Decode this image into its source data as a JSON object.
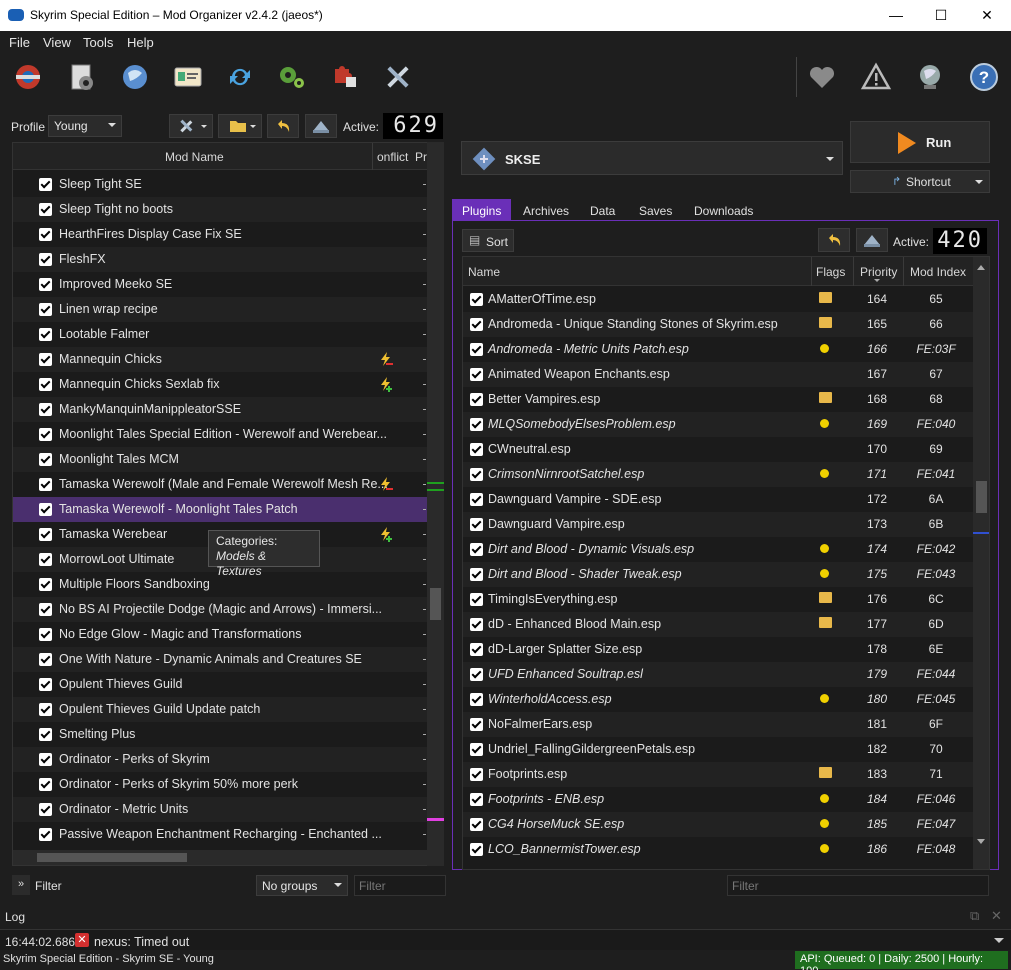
{
  "window": {
    "title": "Skyrim Special Edition – Mod Organizer v2.4.2 (jaeos*)",
    "minimize": "—",
    "maximize": "☐",
    "close": "✕"
  },
  "menu": [
    "File",
    "View",
    "Tools",
    "Help"
  ],
  "toolbar_icons": [
    "profiles-icon",
    "instance-icon",
    "browser-icon",
    "nexus-id-icon",
    "refresh-icon",
    "settings-gears-icon",
    "puzzle-icon",
    "tools-icon",
    "endorse-heart-icon",
    "warning-icon",
    "update-globe-icon",
    "help-icon"
  ],
  "left": {
    "profile_label": "Profile",
    "profile_value": "Young",
    "active_label": "Active:",
    "active_count": "629",
    "columns": {
      "mod_name": "Mod Name",
      "conflict": "onflict",
      "priority": "Pr"
    },
    "mods": [
      {
        "name": "Sleep Tight SE",
        "conflict": ""
      },
      {
        "name": "Sleep Tight no boots",
        "conflict": ""
      },
      {
        "name": "HearthFires Display Case Fix SE",
        "conflict": ""
      },
      {
        "name": "FleshFX",
        "conflict": ""
      },
      {
        "name": "Improved Meeko SE",
        "conflict": ""
      },
      {
        "name": "Linen wrap recipe",
        "conflict": ""
      },
      {
        "name": "Lootable Falmer",
        "conflict": ""
      },
      {
        "name": "Mannequin Chicks",
        "conflict": "lose"
      },
      {
        "name": "Mannequin Chicks Sexlab fix",
        "conflict": "win"
      },
      {
        "name": "MankyManquinManippleatorSSE",
        "conflict": ""
      },
      {
        "name": "Moonlight Tales Special Edition - Werewolf and Werebear...",
        "conflict": ""
      },
      {
        "name": "Moonlight Tales MCM",
        "conflict": ""
      },
      {
        "name": "Tamaska Werewolf (Male and Female Werewolf Mesh Re...",
        "conflict": "lose"
      },
      {
        "name": "Tamaska Werewolf - Moonlight Tales Patch",
        "conflict": "",
        "selected": true
      },
      {
        "name": "Tamaska Werebear",
        "conflict": "win"
      },
      {
        "name": "MorrowLoot Ultimate",
        "conflict": ""
      },
      {
        "name": "Multiple Floors Sandboxing",
        "conflict": ""
      },
      {
        "name": "No BS AI Projectile Dodge (Magic and Arrows) - Immersi...",
        "conflict": ""
      },
      {
        "name": "No Edge Glow - Magic and Transformations",
        "conflict": ""
      },
      {
        "name": "One With Nature - Dynamic Animals and Creatures SE",
        "conflict": ""
      },
      {
        "name": "Opulent Thieves Guild",
        "conflict": ""
      },
      {
        "name": "Opulent Thieves Guild Update patch",
        "conflict": ""
      },
      {
        "name": "Smelting Plus",
        "conflict": ""
      },
      {
        "name": "Ordinator - Perks of Skyrim",
        "conflict": ""
      },
      {
        "name": "Ordinator - Perks of Skyrim 50% more perk",
        "conflict": ""
      },
      {
        "name": "Ordinator - Metric Units",
        "conflict": ""
      },
      {
        "name": "Passive Weapon Enchantment Recharging - Enchanted ...",
        "conflict": ""
      }
    ],
    "tooltip": {
      "title": "Categories:",
      "value": "Models & Textures"
    },
    "filter_label": "Filter",
    "groups_value": "No groups",
    "filter_placeholder": "Filter"
  },
  "right": {
    "executable": "SKSE",
    "run_label": "Run",
    "shortcut_label": "Shortcut",
    "tabs": [
      "Plugins",
      "Archives",
      "Data",
      "Saves",
      "Downloads"
    ],
    "sort_label": "Sort",
    "active_label": "Active:",
    "active_count": "420",
    "columns": {
      "name": "Name",
      "flags": "Flags",
      "priority": "Priority",
      "mod_index": "Mod Index"
    },
    "plugins": [
      {
        "name": "AMatterOfTime.esp",
        "flag": "box",
        "priority": "164",
        "index": "65",
        "light": false
      },
      {
        "name": "Andromeda - Unique Standing Stones of Skyrim.esp",
        "flag": "box",
        "priority": "165",
        "index": "66",
        "light": false
      },
      {
        "name": "Andromeda - Metric Units Patch.esp",
        "flag": "dot",
        "priority": "166",
        "index": "FE:03F",
        "light": true
      },
      {
        "name": "Animated Weapon Enchants.esp",
        "flag": "",
        "priority": "167",
        "index": "67",
        "light": false
      },
      {
        "name": "Better Vampires.esp",
        "flag": "box",
        "priority": "168",
        "index": "68",
        "light": false
      },
      {
        "name": "MLQSomebodyElsesProblem.esp",
        "flag": "dot",
        "priority": "169",
        "index": "FE:040",
        "light": true
      },
      {
        "name": "CWneutral.esp",
        "flag": "",
        "priority": "170",
        "index": "69",
        "light": false
      },
      {
        "name": "CrimsonNirnrootSatchel.esp",
        "flag": "dot",
        "priority": "171",
        "index": "FE:041",
        "light": true
      },
      {
        "name": "Dawnguard Vampire - SDE.esp",
        "flag": "",
        "priority": "172",
        "index": "6A",
        "light": false
      },
      {
        "name": "Dawnguard Vampire.esp",
        "flag": "",
        "priority": "173",
        "index": "6B",
        "light": false
      },
      {
        "name": "Dirt and Blood - Dynamic Visuals.esp",
        "flag": "dot",
        "priority": "174",
        "index": "FE:042",
        "light": true
      },
      {
        "name": "Dirt and Blood - Shader Tweak.esp",
        "flag": "dot",
        "priority": "175",
        "index": "FE:043",
        "light": true
      },
      {
        "name": "TimingIsEverything.esp",
        "flag": "box",
        "priority": "176",
        "index": "6C",
        "light": false
      },
      {
        "name": "dD - Enhanced Blood Main.esp",
        "flag": "box",
        "priority": "177",
        "index": "6D",
        "light": false
      },
      {
        "name": "dD-Larger Splatter Size.esp",
        "flag": "",
        "priority": "178",
        "index": "6E",
        "light": false
      },
      {
        "name": "UFD Enhanced Soultrap.esl",
        "flag": "",
        "priority": "179",
        "index": "FE:044",
        "light": true
      },
      {
        "name": "WinterholdAccess.esp",
        "flag": "dot",
        "priority": "180",
        "index": "FE:045",
        "light": true
      },
      {
        "name": "NoFalmerEars.esp",
        "flag": "",
        "priority": "181",
        "index": "6F",
        "light": false
      },
      {
        "name": "Undriel_FallingGildergreenPetals.esp",
        "flag": "",
        "priority": "182",
        "index": "70",
        "light": false
      },
      {
        "name": "Footprints.esp",
        "flag": "box",
        "priority": "183",
        "index": "71",
        "light": false
      },
      {
        "name": "Footprints - ENB.esp",
        "flag": "dot",
        "priority": "184",
        "index": "FE:046",
        "light": true
      },
      {
        "name": "CG4 HorseMuck SE.esp",
        "flag": "dot",
        "priority": "185",
        "index": "FE:047",
        "light": true
      },
      {
        "name": "LCO_BannermistTower.esp",
        "flag": "dot",
        "priority": "186",
        "index": "FE:048",
        "light": true
      }
    ],
    "filter_placeholder": "Filter"
  },
  "log": {
    "label": "Log",
    "time": "16:44:02.686",
    "message": "nexus: Timed out"
  },
  "status": {
    "left": "Skyrim Special Edition - Skyrim SE - Young",
    "api": "API: Queued: 0 | Daily: 2500 | Hourly: 100"
  },
  "colors": {
    "accent": "#6a2fb8",
    "selected_row": "#4a2f6e",
    "api_bg": "#1f6e1f"
  }
}
